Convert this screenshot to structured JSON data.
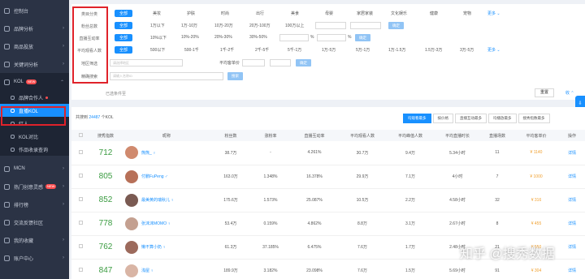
{
  "sidebar": {
    "items": [
      {
        "label": "控制台",
        "arrow": ""
      },
      {
        "label": "品牌分析",
        "arrow": "›"
      },
      {
        "label": "商品投放",
        "arrow": "›"
      },
      {
        "label": "关键词分析",
        "arrow": "›"
      },
      {
        "label": "KOL",
        "badge": "NEW",
        "arrow": "⌃"
      }
    ],
    "sub_items": [
      {
        "label": "品牌合作人",
        "dot": true
      },
      {
        "label": "直播KOL",
        "selected": true
      },
      {
        "label": "红人"
      },
      {
        "label": "KOL对比"
      },
      {
        "label": "作品收录查询"
      }
    ],
    "bottom_items": [
      {
        "label": "MCN",
        "arrow": "›"
      },
      {
        "label": "热门创意灵感",
        "badge": "NEW",
        "arrow": "›"
      },
      {
        "label": "排行榜",
        "arrow": "›"
      },
      {
        "label": "交流反馈社区",
        "arrow": ""
      },
      {
        "label": "我的收藏",
        "arrow": "›"
      },
      {
        "label": "账户中心",
        "arrow": "›"
      }
    ]
  },
  "filters": {
    "rows": [
      {
        "label": "类目分类",
        "options": [
          "全部",
          "美妆",
          "护肤",
          "时尚",
          "出行",
          "美食",
          "母婴",
          "家居家装",
          "文化娱乐",
          "健康",
          "宠物"
        ],
        "more": "更多 ⌄"
      },
      {
        "label": "粉丝总数",
        "options": [
          "全部",
          "1万以下",
          "1万-10万",
          "10万-20万",
          "20万-100万",
          "100万以上"
        ],
        "confirm": "确定"
      },
      {
        "label": "直播互动率",
        "options": [
          "全部",
          "10%以下",
          "10%-20%",
          "20%-30%",
          "30%-50%"
        ],
        "unit_a": "%",
        "unit_b": "%",
        "confirm": "确定"
      },
      {
        "label": "平均观看人数",
        "options": [
          "全部",
          "500以下",
          "500-1千",
          "1千-2千",
          "2千-5千",
          "5千-1万",
          "1万-5万",
          "5万-1万",
          "1万-1.5万",
          "1.5万-3万",
          "3万-5万"
        ],
        "more": "更多 ⌄"
      },
      {
        "label": "地区筛选",
        "region_placeholder": "请选择地区",
        "price_label": "平均客单价",
        "confirm": "确定"
      },
      {
        "label": "精确搜索",
        "search_placeholder": "请输入名称ID",
        "search_btn": "搜索"
      }
    ],
    "selected_tip": "已选条件至",
    "reset": "重置",
    "collapse": "收 ⌃"
  },
  "results": {
    "found_prefix": "共搜到 ",
    "found_count": "24487",
    "found_suffix": " 个KOL",
    "sort_tabs": [
      "均观看最多",
      "按价格",
      "直播互动最多",
      "均播放最多",
      "搜秀指数最多"
    ],
    "columns": [
      "",
      "搜秀指数",
      "昵称",
      "粉丝数",
      "涨粉率",
      "直播互动率",
      "平均观看人数",
      "平均峰值人数",
      "平均直播时长",
      "直播场数",
      "平均客单价",
      "操作"
    ],
    "rows": [
      {
        "score": "712",
        "nickname": "熊熊_ ♀",
        "fans": "38.7万",
        "growth": "-",
        "interact": "4.261%",
        "avg_view": "30.7万",
        "peak": "9.4万",
        "duration": "5.34小时",
        "sessions": "11",
        "price": "¥ 1140",
        "action": "详情"
      },
      {
        "score": "805",
        "nickname": "付鹏FuPeng ♂",
        "fans": "163.0万",
        "growth": "1.348%",
        "interact": "16.378%",
        "avg_view": "29.9万",
        "peak": "7.1万",
        "duration": "4小时",
        "sessions": "7",
        "price": "¥ 1000",
        "action": "详情"
      },
      {
        "score": "852",
        "nickname": "最美黄的瑞秋儿 ♀",
        "fans": "175.6万",
        "growth": "1.573%",
        "interact": "25.087%",
        "avg_view": "10.5万",
        "peak": "2.2万",
        "duration": "4.58小时",
        "sessions": "32",
        "price": "¥ 316",
        "action": "详情"
      },
      {
        "score": "778",
        "nickname": "张沫沫MOMO ♀",
        "fans": "53.4万",
        "growth": "0.159%",
        "interact": "4.862%",
        "avg_view": "8.8万",
        "peak": "3.1万",
        "duration": "2.67小时",
        "sessions": "8",
        "price": "¥ 455",
        "action": "详情"
      },
      {
        "score": "762",
        "nickname": "懒不算小奶 ♀",
        "fans": "61.3万",
        "growth": "37.185%",
        "interact": "6.475%",
        "avg_view": "7.6万",
        "peak": "1.7万",
        "duration": "2.48小时",
        "sessions": "21",
        "price": "¥ 550",
        "action": "详情"
      },
      {
        "score": "847",
        "nickname": "浅屋 ♀",
        "fans": "189.9万",
        "growth": "3.182%",
        "interact": "23.098%",
        "avg_view": "7.6万",
        "peak": "1.5万",
        "duration": "5.69小时",
        "sessions": "91",
        "price": "¥ 304",
        "action": "详情"
      }
    ]
  },
  "watermark": "知乎 @搜秀数据",
  "colors": {
    "accent": "#1890ff",
    "sidebar_bg": "#2b3345",
    "highlight_box": "#e0222a",
    "score_green": "#3a9b40",
    "price_orange": "#f0a030"
  }
}
